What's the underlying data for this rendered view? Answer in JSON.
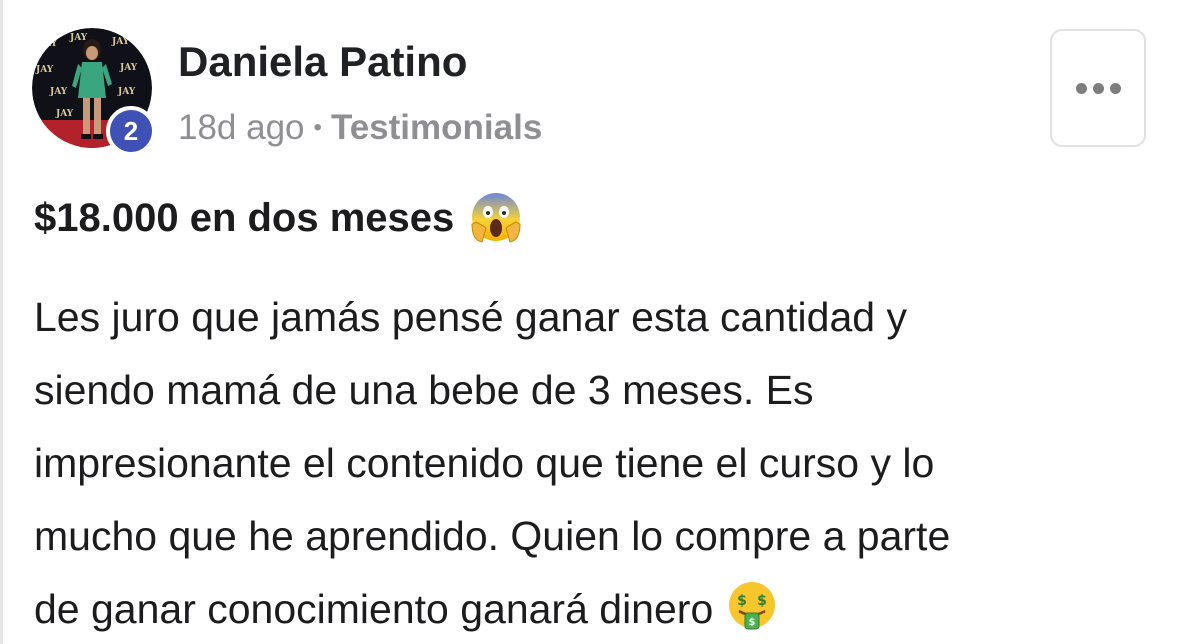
{
  "post": {
    "author": {
      "name": "Daniela Patino",
      "level": "2",
      "avatar_backdrop_text": "JAY"
    },
    "meta": {
      "time_ago": "18d ago",
      "separator": "•",
      "category": "Testimonials"
    },
    "title": "$18.000 en dos meses",
    "title_emoji": "face-screaming-in-fear-icon",
    "body_lines": [
      "Les juro que jamás pensé ganar esta cantidad y",
      "siendo mamá de una bebe de 3 meses. Es",
      "impresionante el contenido que tiene el curso y lo",
      "mucho que he aprendido. Quien lo compre a parte",
      "de ganar conocimiento ganará dinero"
    ],
    "body_end_emoji": "money-mouth-face-icon"
  },
  "colors": {
    "level_badge": "#3f51b5",
    "meta_text": "#8e8e93",
    "text": "#1c1c1e",
    "button_border": "#e0e0e0"
  }
}
